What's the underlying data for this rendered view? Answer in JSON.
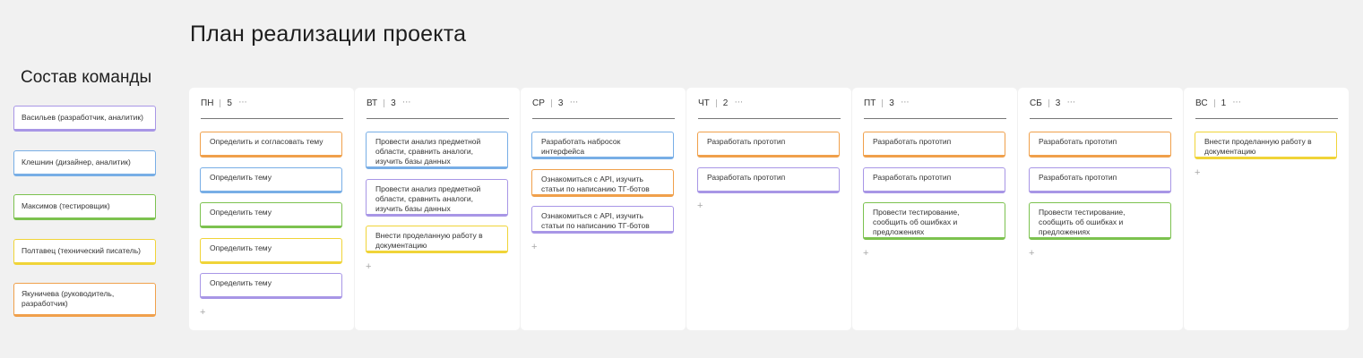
{
  "board": {
    "title": "План реализации проекта"
  },
  "team": {
    "title": "Состав команды",
    "members": [
      {
        "name": "Васильев (разработчик, аналитик)",
        "color": "#a896e6"
      },
      {
        "name": "Клешнин (дизайнер, аналитик)",
        "color": "#78aee6"
      },
      {
        "name": "Максимов (тестировщик)",
        "color": "#7cc24f"
      },
      {
        "name": "Полтавец (технический писатель)",
        "color": "#f0d438"
      },
      {
        "name": "Якуничева (руководитель, разработчик)",
        "color": "#f0a04b"
      }
    ]
  },
  "columns": [
    {
      "day": "ПН",
      "count": "5",
      "more": "···",
      "add": "+",
      "cards": [
        {
          "text": "Определить и согласовать тему",
          "color": "#f0a04b"
        },
        {
          "text": "Определить тему",
          "color": "#78aee6"
        },
        {
          "text": "Определить тему",
          "color": "#7cc24f"
        },
        {
          "text": "Определить тему",
          "color": "#f0d438"
        },
        {
          "text": "Определить тему",
          "color": "#a896e6"
        }
      ]
    },
    {
      "day": "ВТ",
      "count": "3",
      "more": "···",
      "add": "+",
      "cards": [
        {
          "text": "Провести анализ предметной области, сравнить аналоги, изучить базы данных",
          "color": "#78aee6"
        },
        {
          "text": "Провести анализ предметной области, сравнить аналоги, изучить базы данных",
          "color": "#a896e6"
        },
        {
          "text": "Внести  проделанную работу в документацию",
          "color": "#f0d438"
        }
      ]
    },
    {
      "day": "СР",
      "count": "3",
      "more": "···",
      "add": "+",
      "cards": [
        {
          "text": "Разработать набросок интерфейса",
          "color": "#78aee6"
        },
        {
          "text": "Ознакомиться с API, изучить статьи по написанию ТГ-ботов",
          "color": "#f0a04b"
        },
        {
          "text": "Ознакомиться с API, изучить статьи по написанию ТГ-ботов",
          "color": "#a896e6"
        }
      ]
    },
    {
      "day": "ЧТ",
      "count": "2",
      "more": "···",
      "add": "+",
      "cards": [
        {
          "text": "Разработать прототип",
          "color": "#f0a04b"
        },
        {
          "text": "Разработать прототип",
          "color": "#a896e6"
        }
      ]
    },
    {
      "day": "ПТ",
      "count": "3",
      "more": "···",
      "add": "+",
      "cards": [
        {
          "text": "Разработать прототип",
          "color": "#f0a04b"
        },
        {
          "text": "Разработать прототип",
          "color": "#a896e6"
        },
        {
          "text": "Провести тестирование, сообщить об ошибках и предложениях",
          "color": "#7cc24f"
        }
      ]
    },
    {
      "day": "СБ",
      "count": "3",
      "more": "···",
      "add": "+",
      "cards": [
        {
          "text": "Разработать прототип",
          "color": "#f0a04b"
        },
        {
          "text": "Разработать прототип",
          "color": "#a896e6"
        },
        {
          "text": "Провести тестирование, сообщить об ошибках и предложениях",
          "color": "#7cc24f"
        }
      ]
    },
    {
      "day": "ВС",
      "count": "1",
      "more": "···",
      "add": "+",
      "cards": [
        {
          "text": "Внести  проделанную работу в документацию",
          "color": "#f0d438"
        }
      ]
    }
  ]
}
